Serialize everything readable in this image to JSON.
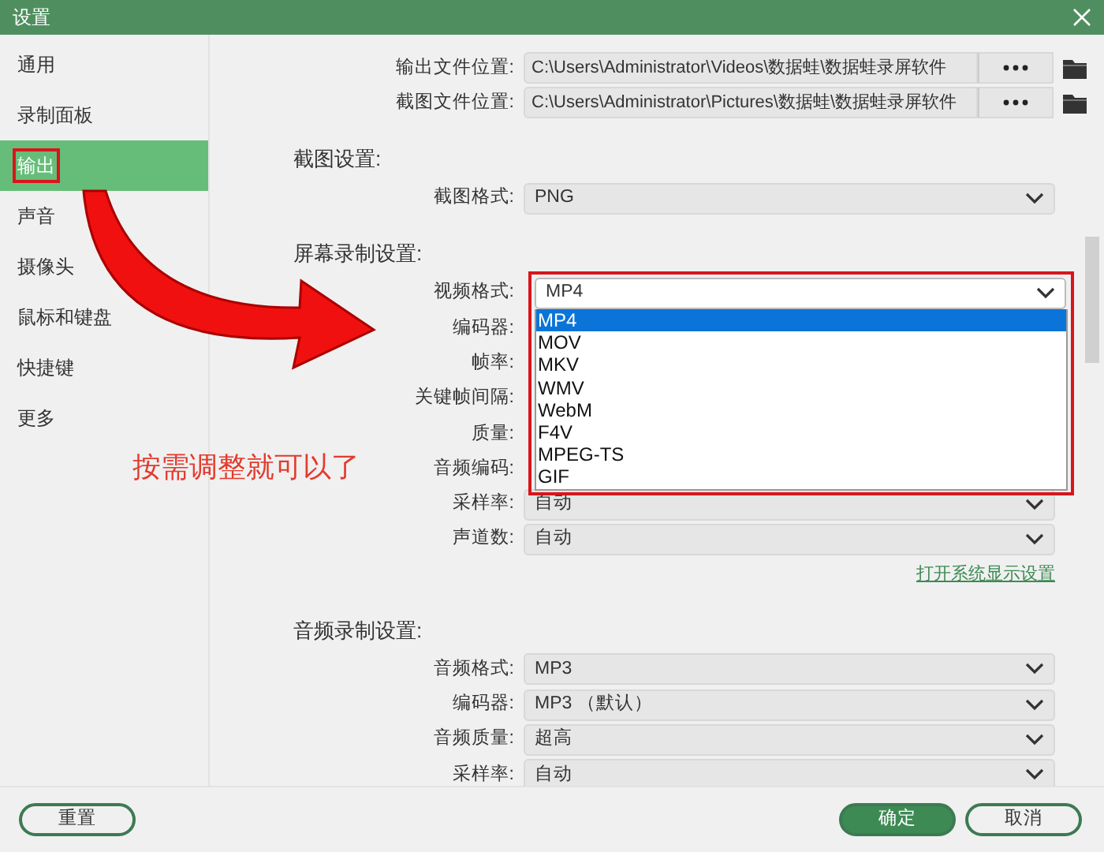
{
  "window": {
    "title": "设置"
  },
  "sidebar": {
    "items": [
      {
        "label": "通用",
        "selected": false,
        "highlighted": false
      },
      {
        "label": "录制面板",
        "selected": false,
        "highlighted": false
      },
      {
        "label": "输出",
        "selected": true,
        "highlighted": true
      },
      {
        "label": "声音",
        "selected": false,
        "highlighted": false
      },
      {
        "label": "摄像头",
        "selected": false,
        "highlighted": false
      },
      {
        "label": "鼠标和键盘",
        "selected": false,
        "highlighted": false
      },
      {
        "label": "快捷键",
        "selected": false,
        "highlighted": false
      },
      {
        "label": "更多",
        "selected": false,
        "highlighted": false
      }
    ]
  },
  "annotation": {
    "text": "按需调整就可以了"
  },
  "paths": [
    {
      "label": "输出文件位置:",
      "value": "C:\\Users\\Administrator\\Videos\\数据蛙\\数据蛙录屏软件"
    },
    {
      "label": "截图文件位置:",
      "value": "C:\\Users\\Administrator\\Pictures\\数据蛙\\数据蛙录屏软件"
    }
  ],
  "sections": [
    {
      "heading": "截图设置:",
      "rows": [
        {
          "label": "截图格式:",
          "value": "PNG"
        }
      ]
    },
    {
      "heading": "屏幕录制设置:",
      "rows": [
        {
          "label": "视频格式:",
          "value": "MP4",
          "open": true
        },
        {
          "label": "编码器:"
        },
        {
          "label": "帧率:"
        },
        {
          "label": "关键帧间隔:"
        },
        {
          "label": "质量:"
        },
        {
          "label": "音频编码:"
        },
        {
          "label": "采样率:",
          "value": "自动"
        },
        {
          "label": "声道数:",
          "value": "自动"
        }
      ],
      "link": "打开系统显示设置"
    },
    {
      "heading": "音频录制设置:",
      "rows": [
        {
          "label": "音频格式:",
          "value": "MP3"
        },
        {
          "label": "编码器:",
          "value": "MP3 （默认）"
        },
        {
          "label": "音频质量:",
          "value": "超高"
        },
        {
          "label": "采样率:",
          "value": "自动"
        }
      ]
    }
  ],
  "dropdown": {
    "options": [
      {
        "label": "MP4",
        "selected": true
      },
      {
        "label": "MOV",
        "selected": false
      },
      {
        "label": "MKV",
        "selected": false
      },
      {
        "label": "WMV",
        "selected": false
      },
      {
        "label": "WebM",
        "selected": false
      },
      {
        "label": "F4V",
        "selected": false
      },
      {
        "label": "MPEG-TS",
        "selected": false
      },
      {
        "label": "GIF",
        "selected": false
      }
    ]
  },
  "footer": {
    "reset": "重置",
    "ok": "确定",
    "cancel": "取消"
  }
}
